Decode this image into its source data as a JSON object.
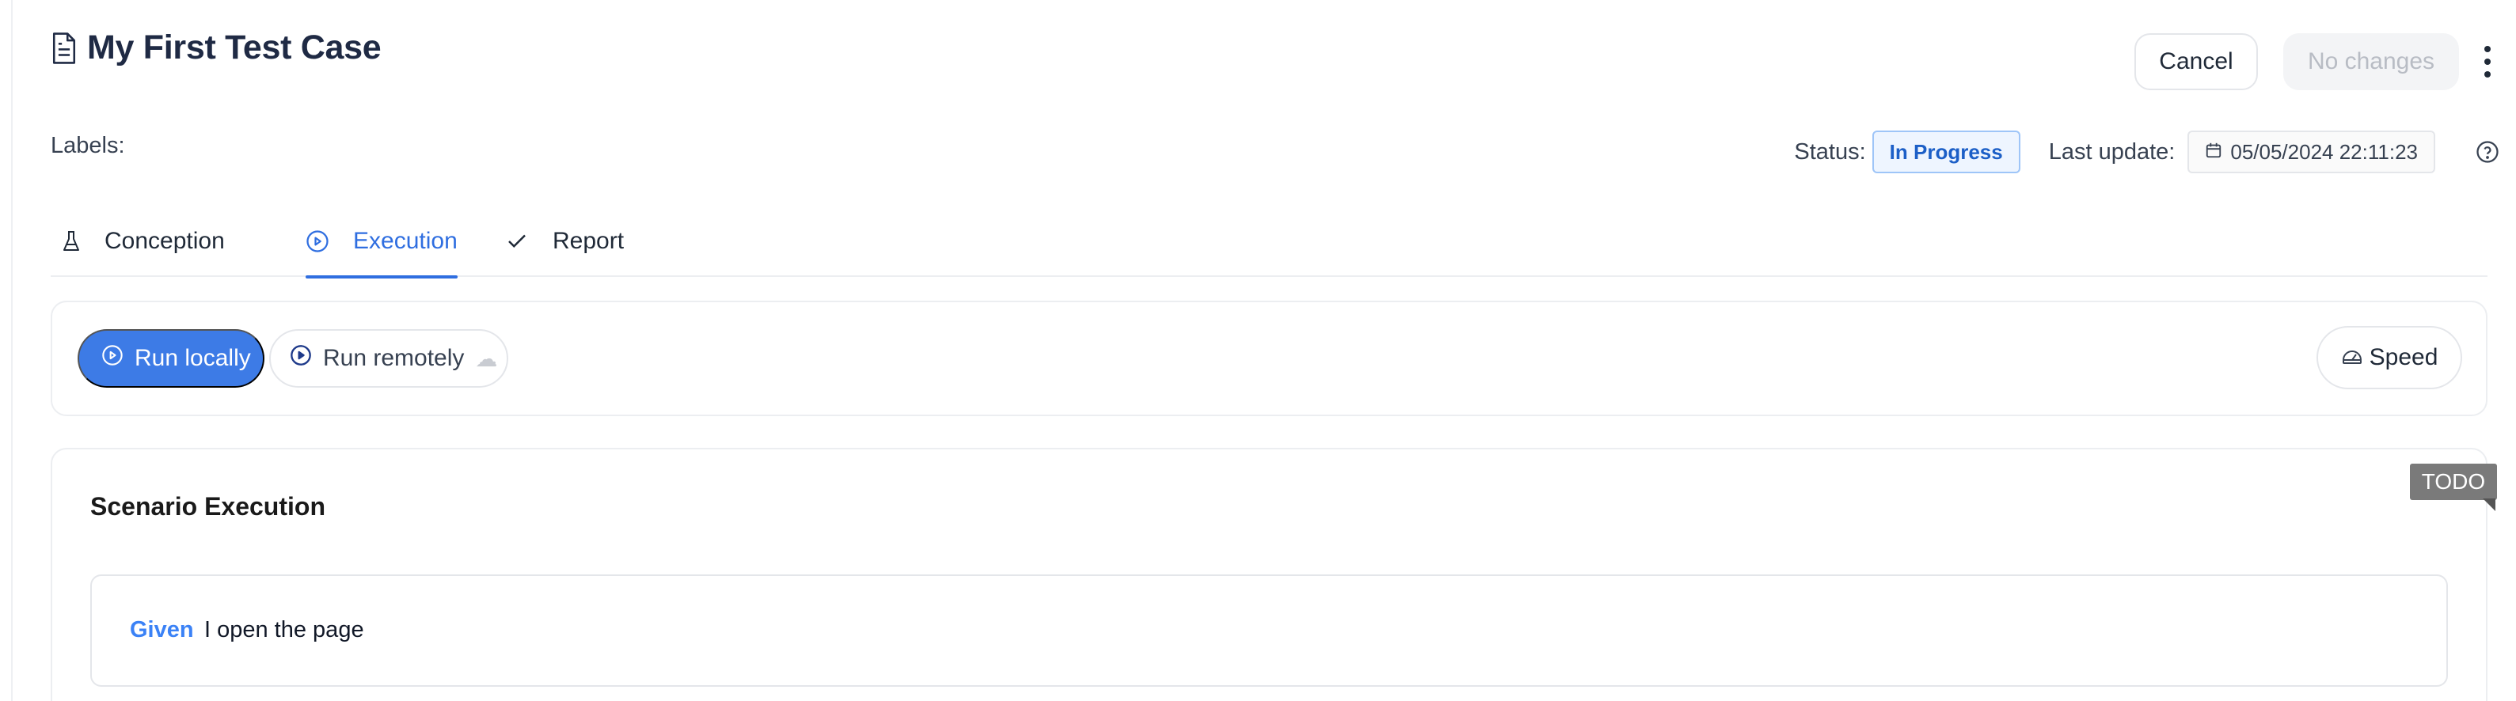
{
  "header": {
    "title": "My First Test Case",
    "cancel_label": "Cancel",
    "save_label": "No changes"
  },
  "labels": {
    "label": "Labels:"
  },
  "meta": {
    "status_label": "Status:",
    "status_value": "In Progress",
    "last_update_label": "Last update:",
    "last_update_value": "05/05/2024 22:11:23"
  },
  "tabs": [
    {
      "label": "Conception",
      "icon": "flask-icon",
      "active": false
    },
    {
      "label": "Execution",
      "icon": "play-circle-icon",
      "active": true
    },
    {
      "label": "Report",
      "icon": "check-icon",
      "active": false
    }
  ],
  "run": {
    "run_locally_label": "Run locally",
    "run_remotely_label": "Run remotely",
    "run_remotely_suffix": "☁",
    "speed_label": "Speed"
  },
  "scenario": {
    "title": "Scenario Execution",
    "steps": [
      {
        "keyword": "Given",
        "text": "I open the page",
        "badge": "TODO"
      }
    ]
  },
  "colors": {
    "accent": "#3d7be6",
    "active_tab": "#2f6ee0",
    "keyword": "#3b82f6",
    "status_bg": "#eef5ff",
    "status_border": "#9ec5f8",
    "todo_bg": "#7a7a7a"
  }
}
